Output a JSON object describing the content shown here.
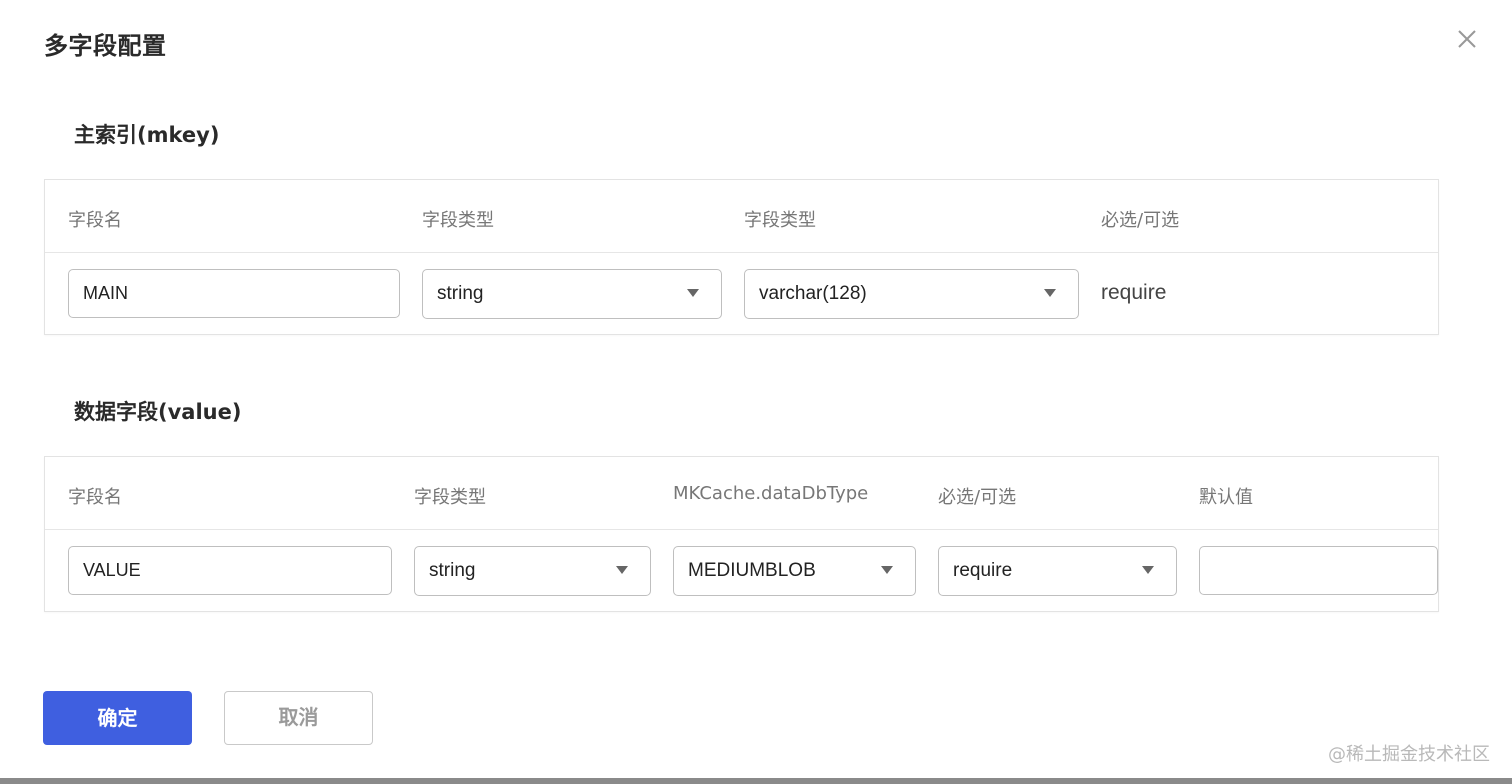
{
  "dialog": {
    "title": "多字段配置",
    "close_icon": "close-icon"
  },
  "primary_index": {
    "title": "主索引(mkey)",
    "columns": [
      "字段名",
      "字段类型",
      "字段类型",
      "必选/可选"
    ],
    "row": {
      "field_name": "MAIN",
      "field_type": "string",
      "db_type": "varchar(128)",
      "required": "require"
    }
  },
  "data_fields": {
    "title": "数据字段(value)",
    "columns": [
      "字段名",
      "字段类型",
      "MKCache.dataDbType",
      "必选/可选",
      "默认值"
    ],
    "row": {
      "field_name": "VALUE",
      "field_type": "string",
      "db_type": "MEDIUMBLOB",
      "required": "require",
      "default_value": ""
    }
  },
  "footer": {
    "ok_label": "确定",
    "cancel_label": "取消",
    "ok_color": "#3f5fe0"
  },
  "watermark": "@稀土掘金技术社区"
}
